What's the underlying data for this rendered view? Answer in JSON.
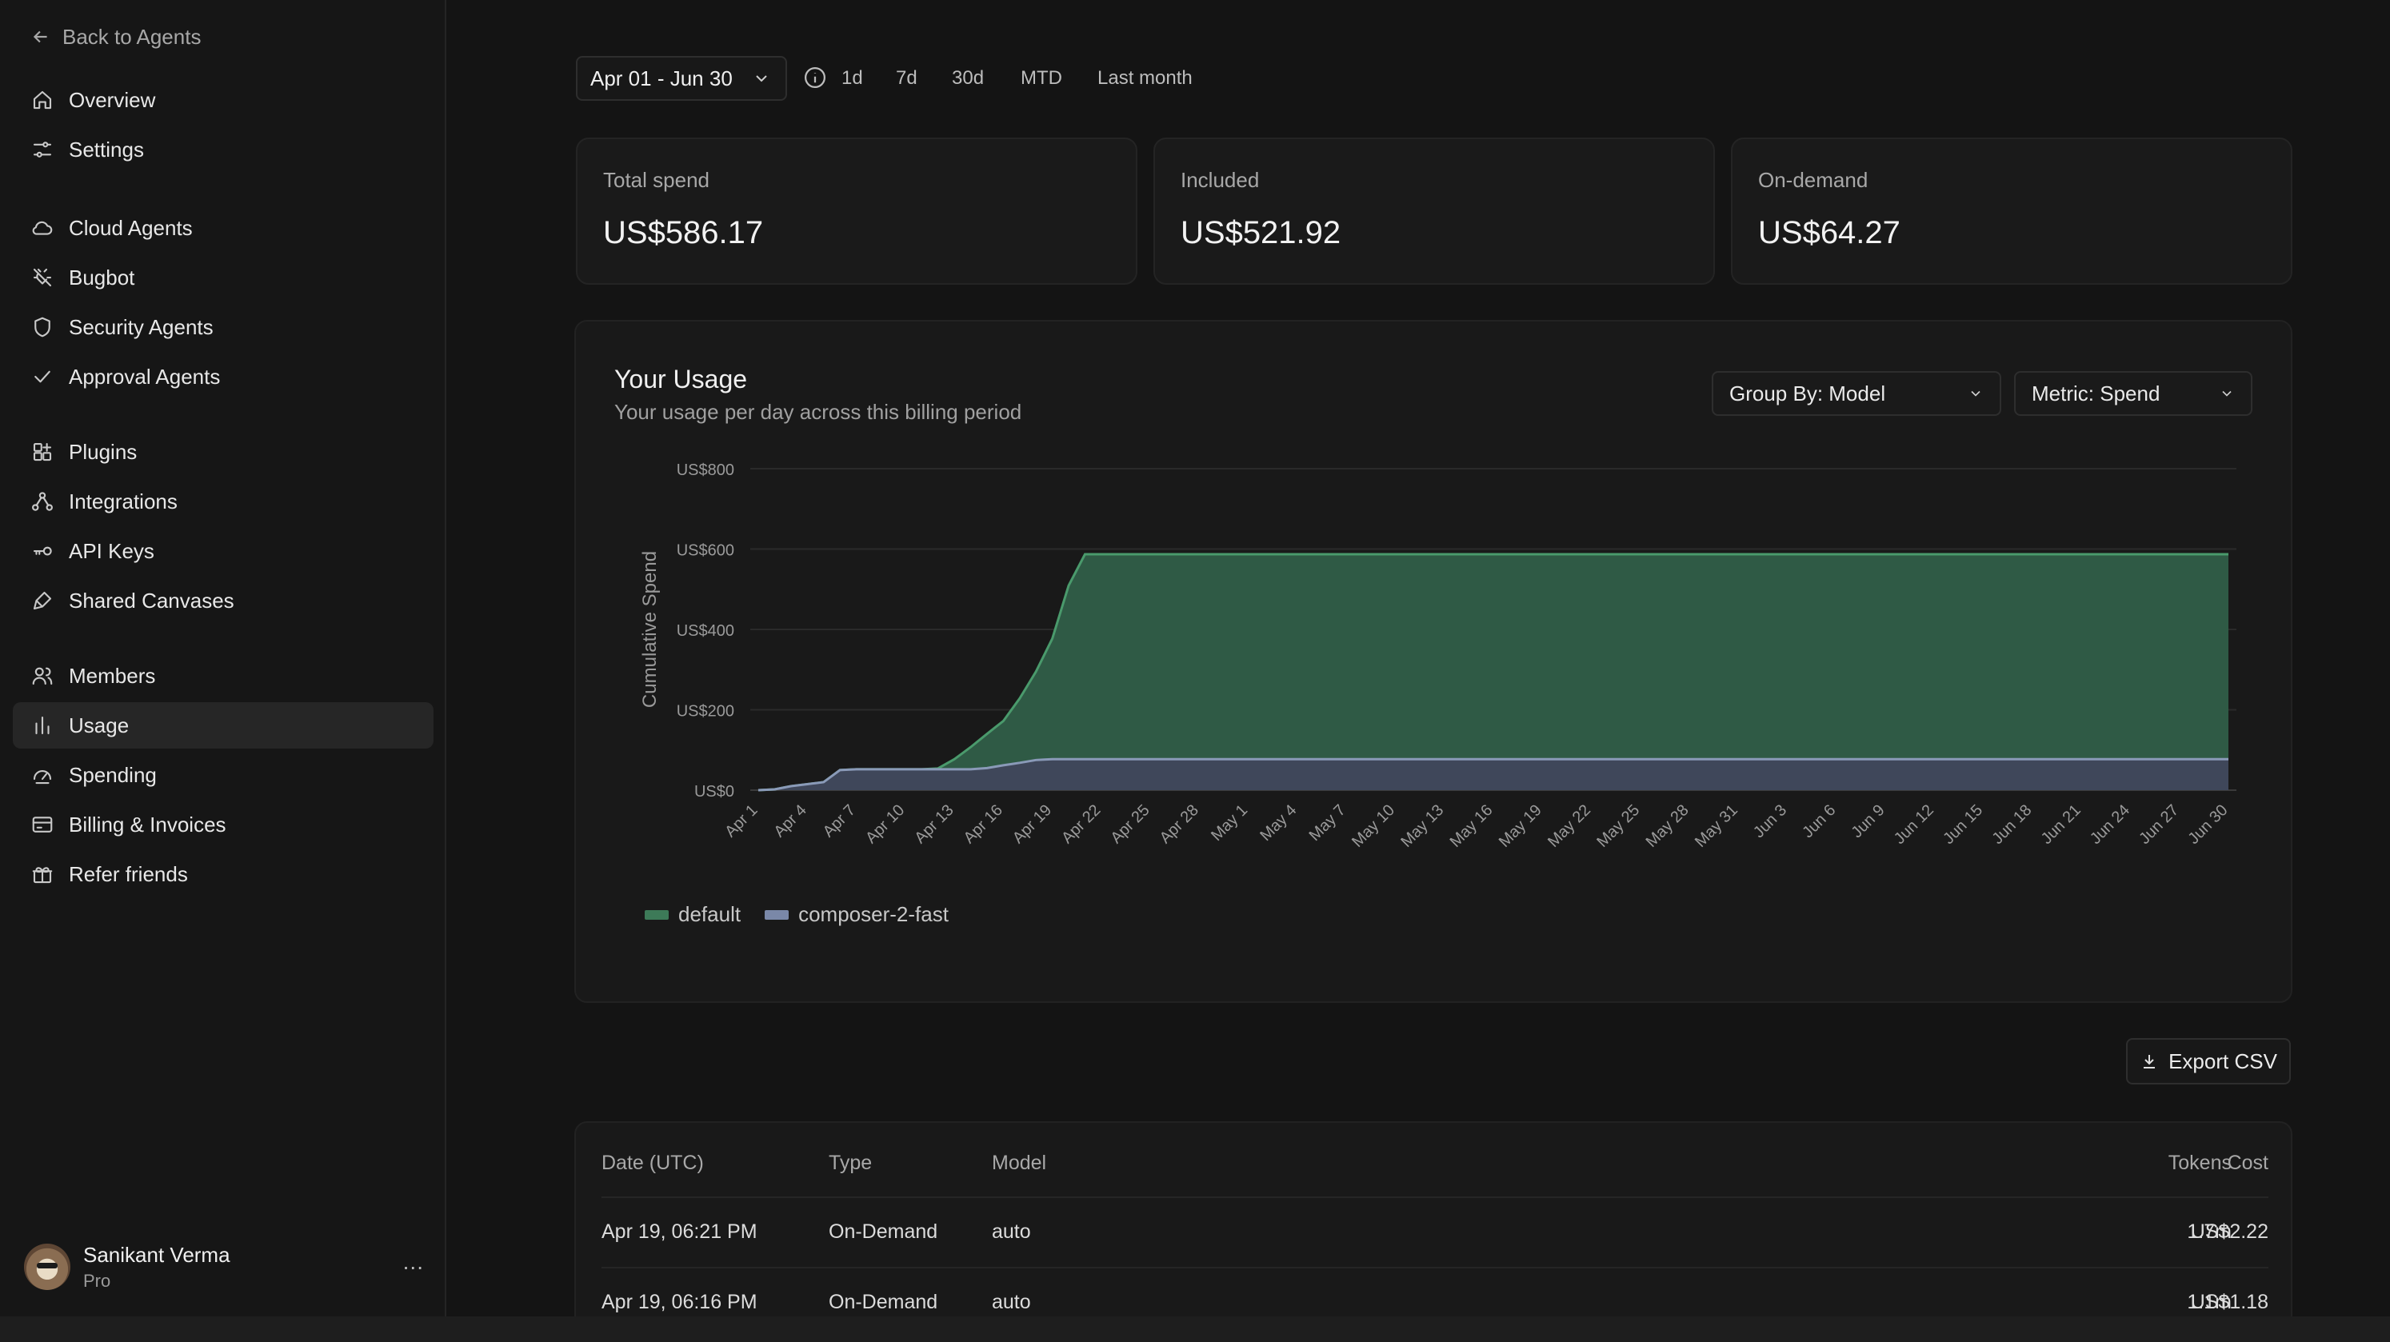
{
  "sidebar": {
    "back_label": "Back to Agents",
    "items": [
      {
        "label": "Overview",
        "icon": "home-icon"
      },
      {
        "label": "Settings",
        "icon": "sliders-icon"
      },
      {
        "label": "Cloud Agents",
        "icon": "cloud-icon"
      },
      {
        "label": "Bugbot",
        "icon": "bug-icon"
      },
      {
        "label": "Security Agents",
        "icon": "shield-icon"
      },
      {
        "label": "Approval Agents",
        "icon": "check-icon"
      },
      {
        "label": "Plugins",
        "icon": "plugin-icon"
      },
      {
        "label": "Integrations",
        "icon": "integrations-icon"
      },
      {
        "label": "API Keys",
        "icon": "key-icon"
      },
      {
        "label": "Shared Canvases",
        "icon": "brush-icon"
      },
      {
        "label": "Members",
        "icon": "users-icon"
      },
      {
        "label": "Usage",
        "icon": "bar-chart-icon",
        "active": true
      },
      {
        "label": "Spending",
        "icon": "gauge-icon"
      },
      {
        "label": "Billing & Invoices",
        "icon": "card-icon"
      },
      {
        "label": "Refer friends",
        "icon": "gift-icon"
      }
    ],
    "user": {
      "name": "Sanikant Verma",
      "plan": "Pro",
      "more": "..."
    }
  },
  "filters": {
    "date_range": "Apr 01 - Jun 30",
    "ranges": [
      "1d",
      "7d",
      "30d",
      "MTD",
      "Last month"
    ]
  },
  "stats": [
    {
      "label": "Total spend",
      "value": "US$586.17"
    },
    {
      "label": "Included",
      "value": "US$521.92"
    },
    {
      "label": "On-demand",
      "value": "US$64.27"
    }
  ],
  "usage": {
    "title": "Your Usage",
    "subtitle": "Your usage per day across this billing period",
    "group_by": "Group By: Model",
    "metric": "Metric: Spend"
  },
  "chart_data": {
    "type": "area",
    "stacked": true,
    "ylabel": "Cumulative Spend",
    "ylim": [
      0,
      800
    ],
    "y_ticks": [
      "US$0",
      "US$200",
      "US$400",
      "US$600",
      "US$800"
    ],
    "x_ticks": [
      "Apr 1",
      "Apr 4",
      "Apr 7",
      "Apr 10",
      "Apr 13",
      "Apr 16",
      "Apr 19",
      "Apr 22",
      "Apr 25",
      "Apr 28",
      "May 1",
      "May 4",
      "May 7",
      "May 10",
      "May 13",
      "May 16",
      "May 19",
      "May 22",
      "May 25",
      "May 28",
      "May 31",
      "Jun 3",
      "Jun 6",
      "Jun 9",
      "Jun 12",
      "Jun 15",
      "Jun 18",
      "Jun 21",
      "Jun 24",
      "Jun 27",
      "Jun 30"
    ],
    "grid": true,
    "legend_position": "bottom-left",
    "series": [
      {
        "name": "composer-2-fast",
        "color": "#7a88a8",
        "points": [
          [
            0,
            0
          ],
          [
            1,
            2
          ],
          [
            2,
            10
          ],
          [
            3,
            15
          ],
          [
            4,
            20
          ],
          [
            5,
            50
          ],
          [
            6,
            52
          ],
          [
            7,
            52
          ],
          [
            8,
            52
          ],
          [
            9,
            52
          ],
          [
            10,
            52
          ],
          [
            11,
            52
          ],
          [
            12,
            52
          ],
          [
            13,
            52
          ],
          [
            14,
            55
          ],
          [
            15,
            62
          ],
          [
            16,
            68
          ],
          [
            17,
            75
          ],
          [
            18,
            77
          ],
          [
            19,
            77
          ],
          [
            90,
            77
          ]
        ]
      },
      {
        "name": "default",
        "color": "#3d7a58",
        "points": [
          [
            0,
            0
          ],
          [
            1,
            0
          ],
          [
            2,
            0
          ],
          [
            3,
            0
          ],
          [
            4,
            0
          ],
          [
            5,
            0
          ],
          [
            6,
            0
          ],
          [
            7,
            0
          ],
          [
            8,
            0
          ],
          [
            9,
            0
          ],
          [
            10,
            0
          ],
          [
            11,
            2
          ],
          [
            12,
            25
          ],
          [
            13,
            55
          ],
          [
            14,
            85
          ],
          [
            15,
            110
          ],
          [
            16,
            160
          ],
          [
            17,
            220
          ],
          [
            18,
            300
          ],
          [
            19,
            432
          ],
          [
            20,
            510
          ],
          [
            90,
            510
          ]
        ]
      }
    ]
  },
  "export_label": "Export CSV",
  "table": {
    "headers": [
      "Date (UTC)",
      "Type",
      "Model",
      "Tokens",
      "Cost"
    ],
    "rows": [
      [
        "Apr 19, 06:21 PM",
        "On-Demand",
        "auto",
        "1.7m",
        "US$2.22"
      ],
      [
        "Apr 19, 06:16 PM",
        "On-Demand",
        "auto",
        "1.1m",
        "US$1.18"
      ]
    ]
  }
}
